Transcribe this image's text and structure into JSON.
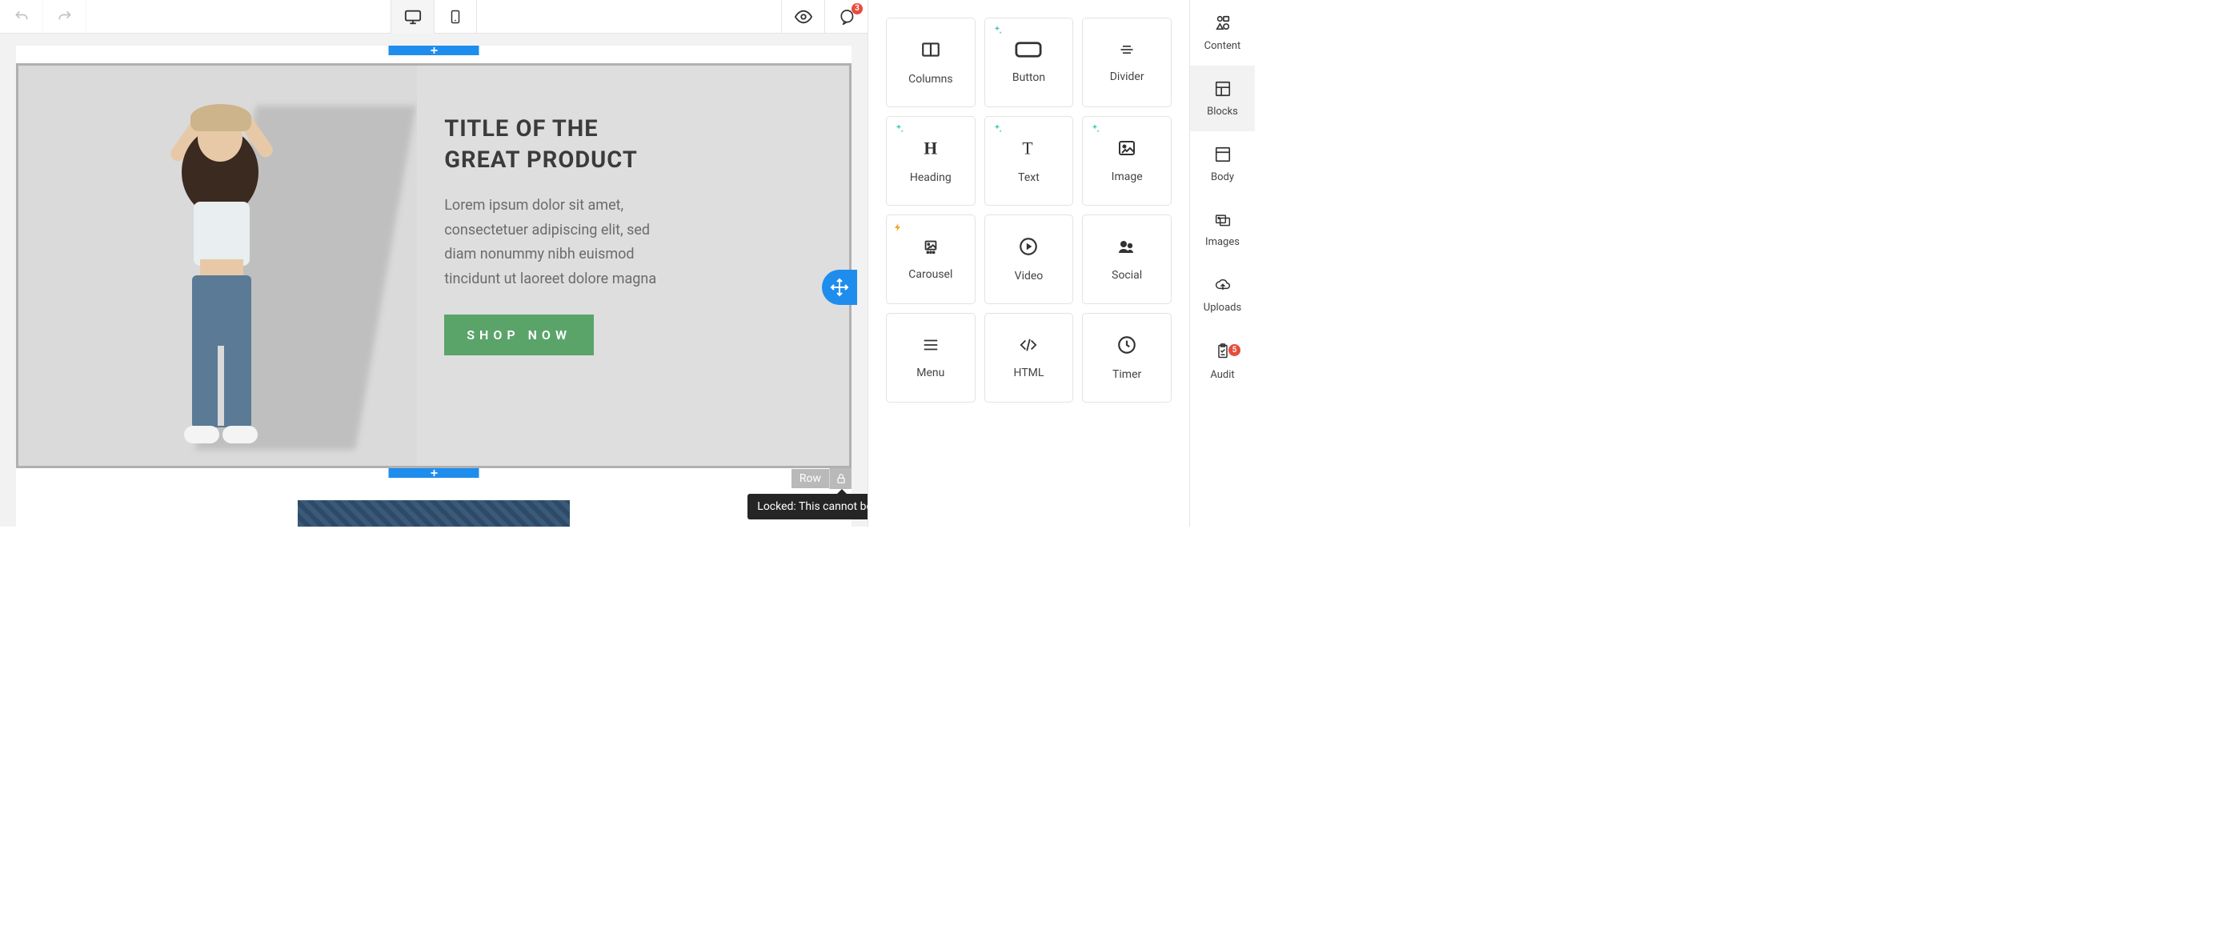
{
  "topbar": {
    "notification_count": "3"
  },
  "canvas": {
    "title_line1": "TITLE OF THE",
    "title_line2": "GREAT PRODUCT",
    "body": "Lorem ipsum dolor sit amet, consectetuer adipiscing elit, sed diam nonummy nibh euismod tincidunt ut laoreet dolore magna",
    "cta": "SHOP NOW",
    "row_label": "Row",
    "tooltip": "Locked: This cannot be edited"
  },
  "blocks": {
    "items": [
      {
        "label": "Columns",
        "decor": "none"
      },
      {
        "label": "Button",
        "decor": "spark"
      },
      {
        "label": "Divider",
        "decor": "none"
      },
      {
        "label": "Heading",
        "decor": "spark"
      },
      {
        "label": "Text",
        "decor": "spark"
      },
      {
        "label": "Image",
        "decor": "spark"
      },
      {
        "label": "Carousel",
        "decor": "bolt"
      },
      {
        "label": "Video",
        "decor": "none"
      },
      {
        "label": "Social",
        "decor": "none"
      },
      {
        "label": "Menu",
        "decor": "none"
      },
      {
        "label": "HTML",
        "decor": "none"
      },
      {
        "label": "Timer",
        "decor": "none"
      }
    ]
  },
  "tabs": {
    "items": [
      {
        "label": "Content"
      },
      {
        "label": "Blocks"
      },
      {
        "label": "Body"
      },
      {
        "label": "Images"
      },
      {
        "label": "Uploads"
      },
      {
        "label": "Audit"
      }
    ],
    "audit_badge": "5",
    "active_index": 1
  }
}
